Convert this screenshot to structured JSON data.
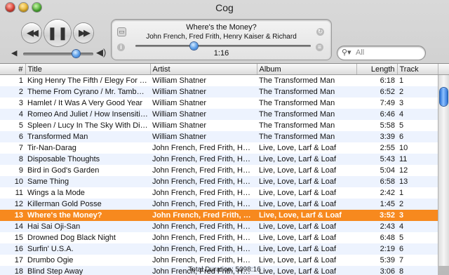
{
  "window": {
    "title": "Cog"
  },
  "controls": {
    "prev_glyph": "◀◀",
    "play_pause_glyph": "❚❚",
    "next_glyph": "▶▶",
    "volume_low_glyph": "◀",
    "volume_high_glyph": "◀)",
    "volume_level": 0.75
  },
  "now_playing": {
    "title": "Where's the Money?",
    "artist": "John French, Fred Frith, Henry Kaiser & Richard",
    "time": "1:16",
    "progress": 0.33
  },
  "search": {
    "placeholder": "All",
    "value": ""
  },
  "playlist": {
    "columns": [
      "#",
      "Title",
      "Artist",
      "Album",
      "Length",
      "Track"
    ],
    "rows": [
      {
        "num": "1",
        "title": "King Henry The Fifth / Elegy For The Brave",
        "artist": "William Shatner",
        "album": "The Transformed Man",
        "length": "6:18",
        "track": "1"
      },
      {
        "num": "2",
        "title": "Theme From Cyrano / Mr. Tambourine Man",
        "artist": "William Shatner",
        "album": "The Transformed Man",
        "length": "6:52",
        "track": "2"
      },
      {
        "num": "3",
        "title": "Hamlet / It Was A Very Good Year",
        "artist": "William Shatner",
        "album": "The Transformed Man",
        "length": "7:49",
        "track": "3"
      },
      {
        "num": "4",
        "title": "Romeo And Juliet / How Insensitive",
        "artist": "William Shatner",
        "album": "The Transformed Man",
        "length": "6:46",
        "track": "4"
      },
      {
        "num": "5",
        "title": "Spleen / Lucy In The Sky With Diamonds",
        "artist": "William Shatner",
        "album": "The Transformed Man",
        "length": "5:58",
        "track": "5"
      },
      {
        "num": "6",
        "title": "Transformed Man",
        "artist": "William Shatner",
        "album": "The Transformed Man",
        "length": "3:39",
        "track": "6"
      },
      {
        "num": "7",
        "title": "Tir-Nan-Darag",
        "artist": "John French, Fred Frith, Henry Kaiser & Richard",
        "album": "Live, Love, Larf & Loaf",
        "length": "2:55",
        "track": "10"
      },
      {
        "num": "8",
        "title": "Disposable Thoughts",
        "artist": "John French, Fred Frith, Henry Kaiser & Richard",
        "album": "Live, Love, Larf & Loaf",
        "length": "5:43",
        "track": "11"
      },
      {
        "num": "9",
        "title": "Bird in God's Garden",
        "artist": "John French, Fred Frith, Henry Kaiser & Richard",
        "album": "Live, Love, Larf & Loaf",
        "length": "5:04",
        "track": "12"
      },
      {
        "num": "10",
        "title": "Same Thing",
        "artist": "John French, Fred Frith, Henry Kaiser & Richard",
        "album": "Live, Love, Larf & Loaf",
        "length": "6:58",
        "track": "13"
      },
      {
        "num": "11",
        "title": "Wings a la Mode",
        "artist": "John French, Fred Frith, Henry Kaiser & Richard",
        "album": "Live, Love, Larf & Loaf",
        "length": "2:42",
        "track": "1"
      },
      {
        "num": "12",
        "title": "Killerman Gold Posse",
        "artist": "John French, Fred Frith, Henry Kaiser & Richard",
        "album": "Live, Love, Larf & Loaf",
        "length": "1:45",
        "track": "2"
      },
      {
        "num": "13",
        "title": "Where's the Money?",
        "artist": "John French, Fred Frith, Henry Kaiser & Richard",
        "album": "Live, Love, Larf & Loaf",
        "length": "3:52",
        "track": "3",
        "selected": true
      },
      {
        "num": "14",
        "title": "Hai Sai Oji-San",
        "artist": "John French, Fred Frith, Henry Kaiser & Richard",
        "album": "Live, Love, Larf & Loaf",
        "length": "2:43",
        "track": "4"
      },
      {
        "num": "15",
        "title": "Drowned Dog Black Night",
        "artist": "John French, Fred Frith, Henry Kaiser & Richard",
        "album": "Live, Love, Larf & Loaf",
        "length": "6:48",
        "track": "5"
      },
      {
        "num": "16",
        "title": "Surfin' U.S.A.",
        "artist": "John French, Fred Frith, Henry Kaiser & Richard",
        "album": "Live, Love, Larf & Loaf",
        "length": "2:19",
        "track": "6"
      },
      {
        "num": "17",
        "title": "Drumbo Ogie",
        "artist": "John French, Fred Frith, Henry Kaiser & Richard",
        "album": "Live, Love, Larf & Loaf",
        "length": "5:39",
        "track": "7"
      },
      {
        "num": "18",
        "title": "Blind Step Away",
        "artist": "John French, Fred Frith, Henry Kaiser & Richard",
        "album": "Live, Love, Larf & Loaf",
        "length": "3:06",
        "track": "8"
      }
    ]
  },
  "status": {
    "total_duration": "Total Duration: 5098:16"
  },
  "colors": {
    "selection": "#f7891e",
    "alt_row": "#edf3fe",
    "scroll_thumb": "#2b72d6"
  }
}
